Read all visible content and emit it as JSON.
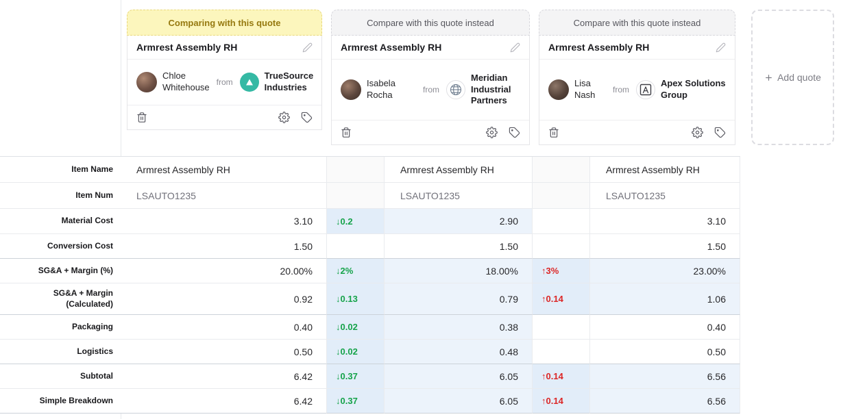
{
  "labels": {
    "from": "from"
  },
  "cards": [
    {
      "header": "Comparing with this quote",
      "title": "Armrest Assembly RH",
      "person_name": "Chloe Whitehouse",
      "company_name": "TrueSource Industries"
    },
    {
      "header": "Compare with this quote instead",
      "title": "Armrest Assembly RH",
      "person_name": "Isabela Rocha",
      "company_name": "Meridian Industrial Partners"
    },
    {
      "header": "Compare with this quote instead",
      "title": "Armrest Assembly RH",
      "person_name": "Lisa Nash",
      "company_name": "Apex Solutions Group"
    }
  ],
  "add_quote": {
    "label": "Add quote"
  },
  "table": {
    "rows": [
      {
        "label": "Item Name",
        "v1": "Armrest Assembly RH",
        "d1": "",
        "v2": "Armrest Assembly RH",
        "d2": "",
        "v3": "Armrest Assembly RH"
      },
      {
        "label": "Item Num",
        "v1": "LSAUTO1235",
        "d1": "",
        "v2": "LSAUTO1235",
        "d2": "",
        "v3": "LSAUTO1235"
      },
      {
        "label": "Material Cost",
        "v1": "3.10",
        "d1": "↓0.2",
        "v2": "2.90",
        "d2": "",
        "v3": "3.10"
      },
      {
        "label": "Conversion Cost",
        "v1": "1.50",
        "d1": "",
        "v2": "1.50",
        "d2": "",
        "v3": "1.50"
      },
      {
        "label": "SG&A + Margin (%)",
        "v1": "20.00%",
        "d1": "↓2%",
        "v2": "18.00%",
        "d2": "↑3%",
        "v3": "23.00%"
      },
      {
        "label": "SG&A + Margin (Calculated)",
        "v1": "0.92",
        "d1": "↓0.13",
        "v2": "0.79",
        "d2": "↑0.14",
        "v3": "1.06"
      },
      {
        "label": "Packaging",
        "v1": "0.40",
        "d1": "↓0.02",
        "v2": "0.38",
        "d2": "",
        "v3": "0.40"
      },
      {
        "label": "Logistics",
        "v1": "0.50",
        "d1": "↓0.02",
        "v2": "0.48",
        "d2": "",
        "v3": "0.50"
      },
      {
        "label": "Subtotal",
        "v1": "6.42",
        "d1": "↓0.37",
        "v2": "6.05",
        "d2": "↑0.14",
        "v3": "6.56"
      },
      {
        "label": "Simple Breakdown",
        "v1": "6.42",
        "d1": "↓0.37",
        "v2": "6.05",
        "d2": "↑0.14",
        "v3": "6.56"
      }
    ]
  },
  "colors": {
    "active_quote_header_bg": "#fcf6bd",
    "active_quote_header_text": "#96790f",
    "decrease_delta": "#16a34a",
    "increase_delta": "#dc2626",
    "changed_value_cell_bg": "#ecf3fb",
    "changed_delta_cell_bg": "#e2edf9"
  }
}
